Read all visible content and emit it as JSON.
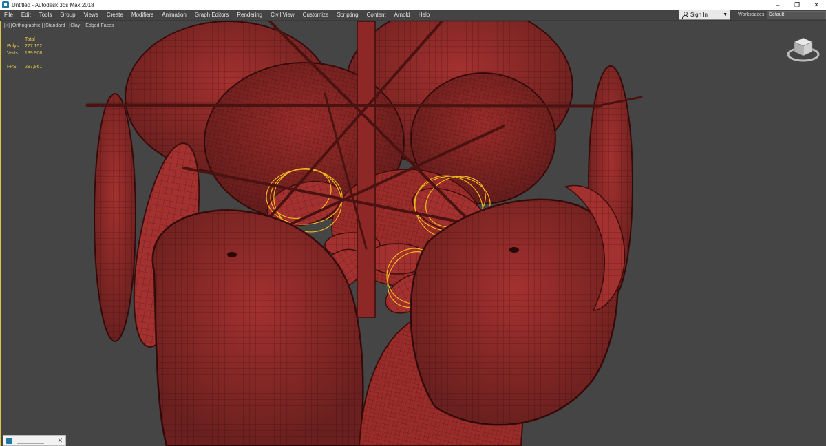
{
  "window": {
    "title": "Untitled - Autodesk 3ds Max 2018",
    "controls": [
      "–",
      "❐",
      "✕"
    ]
  },
  "menu": {
    "items": [
      "File",
      "Edit",
      "Tools",
      "Group",
      "Views",
      "Create",
      "Modifiers",
      "Animation",
      "Graph Editors",
      "Rendering",
      "Civil View",
      "Customize",
      "Scripting",
      "Content",
      "Arnold",
      "Help"
    ],
    "sign_in": "Sign In",
    "workspaces_label": "Workspaces:",
    "workspace_value": "Default"
  },
  "viewport": {
    "label": "[+] [Orthographic ] [Standard ] [Clay + Edged Faces ]",
    "stats": {
      "header": "Total",
      "polys_label": "Polys:",
      "polys_value": "277 152",
      "verts_label": "Verts:",
      "verts_value": "139 908",
      "fps_label": "FPS:",
      "fps_value": "287,861"
    }
  },
  "colors": {
    "mesh": "#a3312f",
    "mesh_dark": "#6e1a18",
    "wire": "#3d0d0c",
    "selection": "#f0b820",
    "viewport_bg": "#454545",
    "active_border": "#d9c54a"
  }
}
